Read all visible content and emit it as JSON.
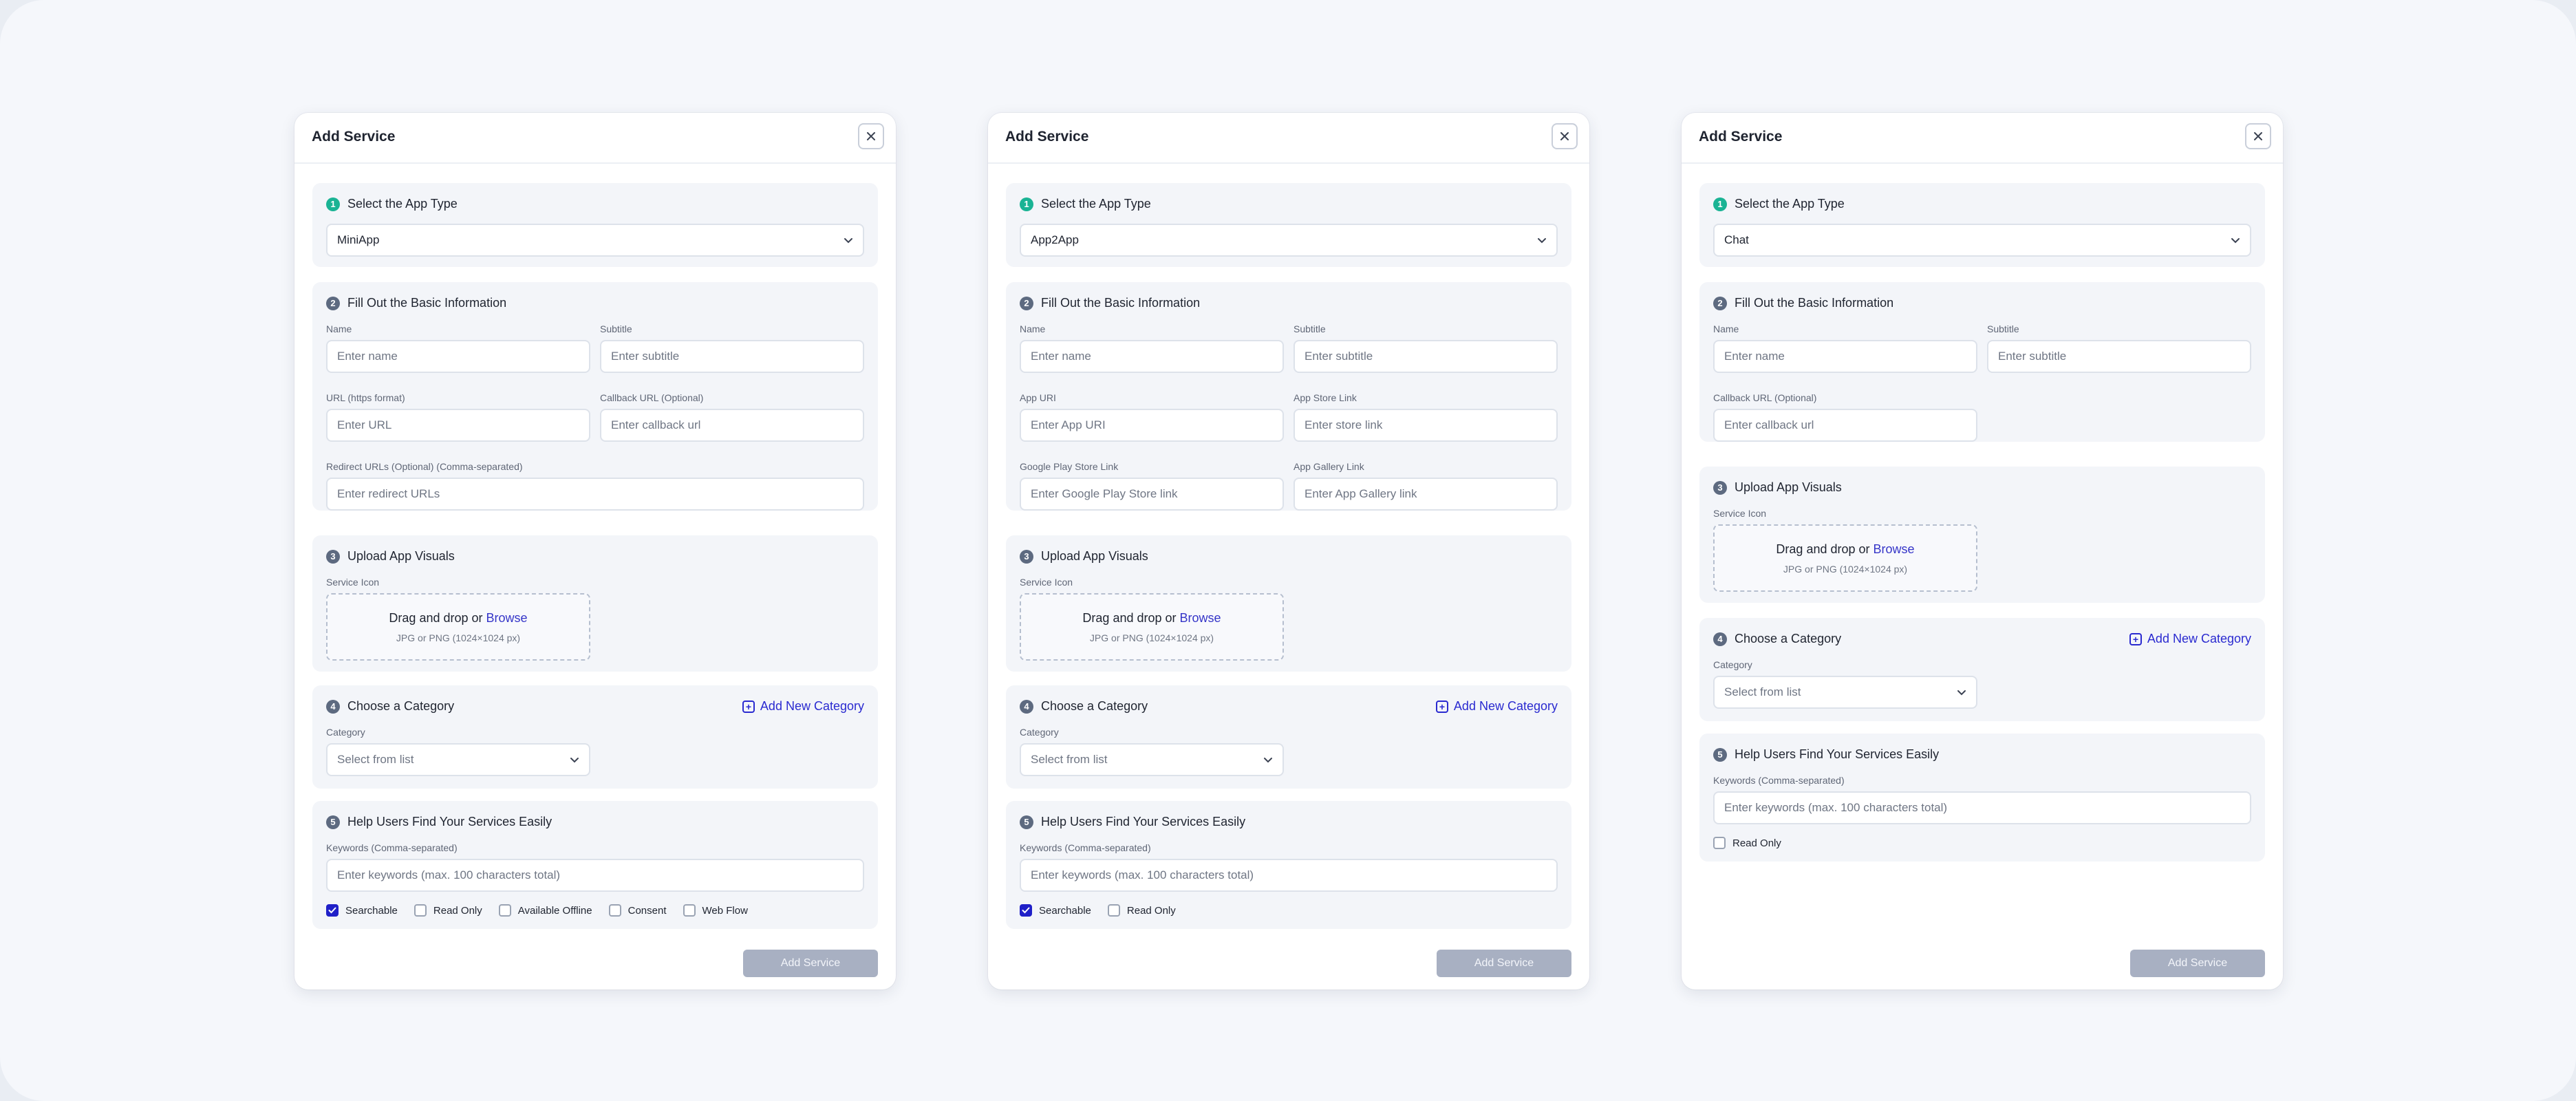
{
  "modals": [
    {
      "title": "Add Service",
      "step1": {
        "num": "1",
        "title": "Select the App Type",
        "selected": "MiniApp"
      },
      "step2": {
        "num": "2",
        "title": "Fill Out the Basic Information",
        "name_label": "Name",
        "name_placeholder": "Enter name",
        "subtitle_label": "Subtitle",
        "subtitle_placeholder": "Enter subtitle",
        "url_label": "URL (https format)",
        "url_placeholder": "Enter URL",
        "callback_label": "Callback URL (Optional)",
        "callback_placeholder": "Enter callback url",
        "redirect_label": "Redirect URLs (Optional) (Comma-separated)",
        "redirect_placeholder": "Enter redirect URLs"
      },
      "step3": {
        "num": "3",
        "title": "Upload App Visuals",
        "icon_label": "Service Icon",
        "drop_text": "Drag and drop or",
        "browse": "Browse",
        "hint": "JPG or PNG (1024×1024 px)"
      },
      "step4": {
        "num": "4",
        "title": "Choose a Category",
        "add_new": "Add New Category",
        "category_label": "Category",
        "category_placeholder": "Select from list"
      },
      "step5": {
        "num": "5",
        "title": "Help Users Find Your Services Easily",
        "keywords_label": "Keywords (Comma-separated)",
        "keywords_placeholder": "Enter keywords (max. 100 characters total)"
      },
      "checkboxes": [
        {
          "label": "Searchable",
          "checked": true
        },
        {
          "label": "Read Only",
          "checked": false
        },
        {
          "label": "Available Offline",
          "checked": false
        },
        {
          "label": "Consent",
          "checked": false
        },
        {
          "label": "Web Flow",
          "checked": false
        }
      ],
      "submit_label": "Add Service"
    },
    {
      "title": "Add Service",
      "step1": {
        "num": "1",
        "title": "Select the App Type",
        "selected": "App2App"
      },
      "step2": {
        "num": "2",
        "title": "Fill Out the Basic Information",
        "name_label": "Name",
        "name_placeholder": "Enter name",
        "subtitle_label": "Subtitle",
        "subtitle_placeholder": "Enter subtitle",
        "app_uri_label": "App URI",
        "app_uri_placeholder": "Enter App URI",
        "app_store_label": "App Store Link",
        "app_store_placeholder": "Enter store link",
        "play_store_label": "Google Play Store Link",
        "play_store_placeholder": "Enter Google Play Store link",
        "gallery_label": "App Gallery Link",
        "gallery_placeholder": "Enter App Gallery link"
      },
      "step3": {
        "num": "3",
        "title": "Upload App Visuals",
        "icon_label": "Service Icon",
        "drop_text": "Drag and drop or",
        "browse": "Browse",
        "hint": "JPG or PNG (1024×1024 px)"
      },
      "step4": {
        "num": "4",
        "title": "Choose a Category",
        "add_new": "Add New Category",
        "category_label": "Category",
        "category_placeholder": "Select from list"
      },
      "step5": {
        "num": "5",
        "title": "Help Users Find Your Services Easily",
        "keywords_label": "Keywords (Comma-separated)",
        "keywords_placeholder": "Enter keywords (max. 100 characters total)"
      },
      "checkboxes": [
        {
          "label": "Searchable",
          "checked": true
        },
        {
          "label": "Read Only",
          "checked": false
        }
      ],
      "submit_label": "Add Service"
    },
    {
      "title": "Add Service",
      "step1": {
        "num": "1",
        "title": "Select the App Type",
        "selected": "Chat"
      },
      "step2": {
        "num": "2",
        "title": "Fill Out the Basic Information",
        "name_label": "Name",
        "name_placeholder": "Enter name",
        "subtitle_label": "Subtitle",
        "subtitle_placeholder": "Enter subtitle",
        "callback_label": "Callback URL (Optional)",
        "callback_placeholder": "Enter callback url"
      },
      "step3": {
        "num": "3",
        "title": "Upload App Visuals",
        "icon_label": "Service Icon",
        "drop_text": "Drag and drop or",
        "browse": "Browse",
        "hint": "JPG or PNG (1024×1024 px)"
      },
      "step4": {
        "num": "4",
        "title": "Choose a Category",
        "add_new": "Add New Category",
        "category_label": "Category",
        "category_placeholder": "Select from list"
      },
      "step5": {
        "num": "5",
        "title": "Help Users Find Your Services Easily",
        "keywords_label": "Keywords (Comma-separated)",
        "keywords_placeholder": "Enter keywords (max. 100 characters total)"
      },
      "checkboxes": [
        {
          "label": "Read Only",
          "checked": false
        }
      ],
      "submit_label": "Add Service"
    }
  ],
  "icons": {
    "close": "close-icon",
    "chevron": "chevron-down-icon",
    "add": "plus-square-icon",
    "check": "checkmark-icon"
  },
  "colors": {
    "step_active": "#1ab394",
    "step_default": "#5d6a80",
    "link": "#2a2ad0",
    "checked": "#2020c8",
    "submit_disabled": "#a8b0c2"
  }
}
